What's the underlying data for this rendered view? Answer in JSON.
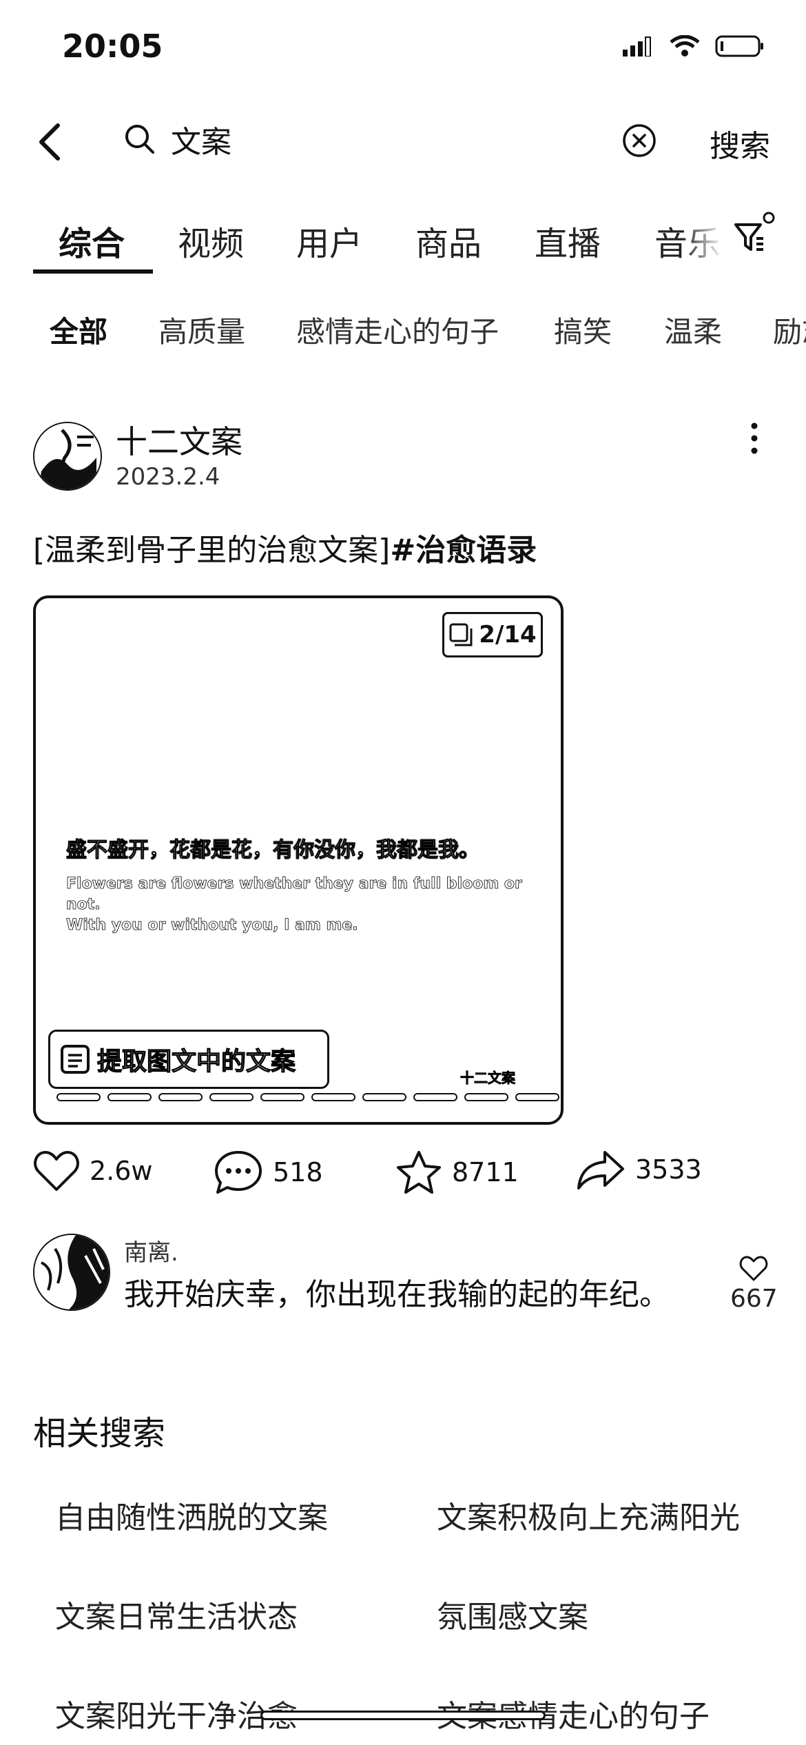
{
  "status": {
    "time": "20:05"
  },
  "search": {
    "query": "文案",
    "button": "搜索"
  },
  "tabs": [
    {
      "label": "综合",
      "active": true
    },
    {
      "label": "视频"
    },
    {
      "label": "用户"
    },
    {
      "label": "商品"
    },
    {
      "label": "直播"
    },
    {
      "label": "音乐"
    }
  ],
  "chips": [
    {
      "label": "全部",
      "active": true
    },
    {
      "label": "高质量"
    },
    {
      "label": "感情走心的句子"
    },
    {
      "label": "搞笑"
    },
    {
      "label": "温柔"
    },
    {
      "label": "励志"
    }
  ],
  "post": {
    "author": "十二文案",
    "date": "2023.2.4",
    "caption_plain": "[温柔到骨子里的治愈文案]",
    "caption_tag": "#治愈语录",
    "image": {
      "page_badge": "2/14",
      "quote_cn": "盛不盛开，花都是花，有你没你，我都是我。",
      "quote_en_line1": "Flowers are flowers whether they are in full bloom or not.",
      "quote_en_line2": "With you or without you, I am me.",
      "extract_label": "提取图文中的文案",
      "watermark": "十二文案",
      "pages_total": 14,
      "current_page": 2
    },
    "likes": "2.6w",
    "comments": "518",
    "favorites": "8711",
    "shares": "3533"
  },
  "comment": {
    "user": "南离.",
    "text": "我开始庆幸，你出现在我输的起的年纪。",
    "likes": "667"
  },
  "related": {
    "title": "相关搜索",
    "items": [
      "自由随性洒脱的文案",
      "文案积极向上充满阳光",
      "文案日常生活状态",
      "氛围感文案",
      "文案阳光干净治愈",
      "文案感情走心的句子"
    ]
  }
}
